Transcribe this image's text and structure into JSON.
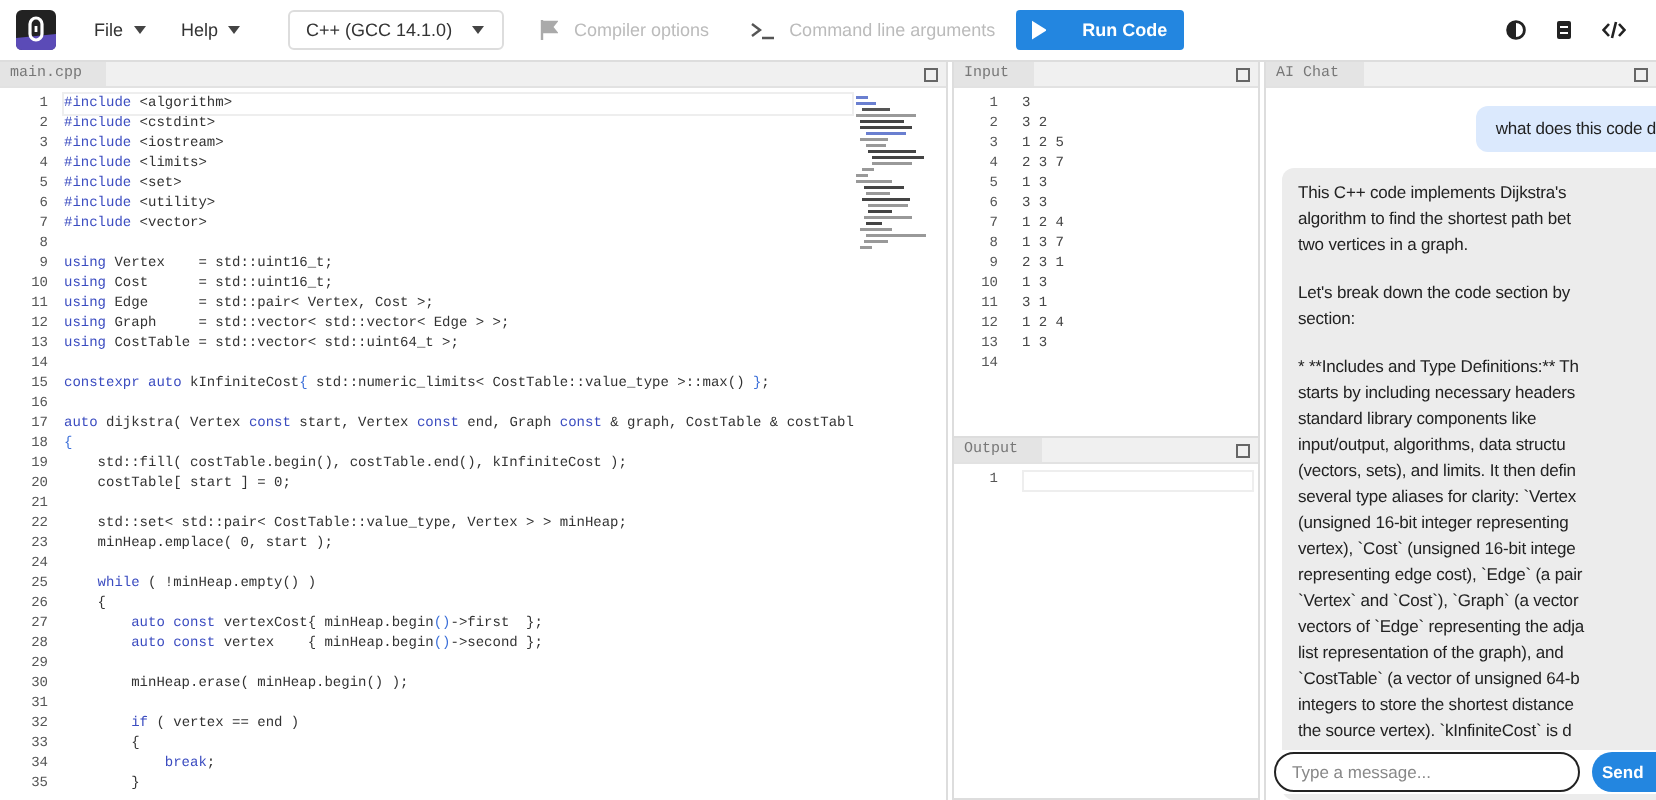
{
  "toolbar": {
    "menus": [
      {
        "label": "File"
      },
      {
        "label": "Help"
      }
    ],
    "language": "C++ (GCC 14.1.0)",
    "options": [
      {
        "label": "Compiler options",
        "kind": "flag",
        "disabled": true
      },
      {
        "label": "Command line arguments",
        "kind": "terminal",
        "disabled": true
      }
    ],
    "run_button": "Run Code"
  },
  "editor": {
    "tab": "main.cpp",
    "lines": [
      {
        "number": "1",
        "tokens": [
          {
            "kind": "keyword",
            "text": "#include"
          },
          {
            "kind": "plain",
            "text": " <algorithm>"
          }
        ]
      },
      {
        "number": "2",
        "tokens": [
          {
            "kind": "keyword",
            "text": "#include"
          },
          {
            "kind": "plain",
            "text": " <cstdint>"
          }
        ]
      },
      {
        "number": "3",
        "tokens": [
          {
            "kind": "keyword",
            "text": "#include"
          },
          {
            "kind": "plain",
            "text": " <iostream>"
          }
        ]
      },
      {
        "number": "4",
        "tokens": [
          {
            "kind": "keyword",
            "text": "#include"
          },
          {
            "kind": "plain",
            "text": " <limits>"
          }
        ]
      },
      {
        "number": "5",
        "tokens": [
          {
            "kind": "keyword",
            "text": "#include"
          },
          {
            "kind": "plain",
            "text": " <set>"
          }
        ]
      },
      {
        "number": "6",
        "tokens": [
          {
            "kind": "keyword",
            "text": "#include"
          },
          {
            "kind": "plain",
            "text": " <utility>"
          }
        ]
      },
      {
        "number": "7",
        "tokens": [
          {
            "kind": "keyword",
            "text": "#include"
          },
          {
            "kind": "plain",
            "text": " <vector>"
          }
        ]
      },
      {
        "number": "8"
      },
      {
        "number": "9",
        "tokens": [
          {
            "kind": "keyword",
            "text": "using"
          },
          {
            "kind": "plain",
            "text": " Vertex    = std::uint16_t;"
          }
        ]
      },
      {
        "number": "10",
        "tokens": [
          {
            "kind": "keyword",
            "text": "using"
          },
          {
            "kind": "plain",
            "text": " Cost      = std::uint16_t;"
          }
        ]
      },
      {
        "number": "11",
        "tokens": [
          {
            "kind": "keyword",
            "text": "using"
          },
          {
            "kind": "plain",
            "text": " Edge      = std::pair< Vertex, Cost >;"
          }
        ]
      },
      {
        "number": "12",
        "tokens": [
          {
            "kind": "keyword",
            "text": "using"
          },
          {
            "kind": "plain",
            "text": " Graph     = std::vector< std::vector< Edge > >;"
          }
        ]
      },
      {
        "number": "13",
        "tokens": [
          {
            "kind": "keyword",
            "text": "using"
          },
          {
            "kind": "plain",
            "text": " CostTable = std::vector< std::uint64_t >;"
          }
        ]
      },
      {
        "number": "14"
      },
      {
        "number": "15",
        "tokens": [
          {
            "kind": "keyword",
            "text": "constexpr auto"
          },
          {
            "kind": "plain",
            "text": " kInfiniteCost"
          },
          {
            "kind": "bracket",
            "text": "{"
          },
          {
            "kind": "plain",
            "text": " std::numeric_limits< CostTable::value_type >::max() "
          },
          {
            "kind": "bracket",
            "text": "}"
          },
          {
            "kind": "plain",
            "text": ";"
          }
        ]
      },
      {
        "number": "16"
      },
      {
        "number": "17",
        "tokens": [
          {
            "kind": "keyword",
            "text": "auto"
          },
          {
            "kind": "plain",
            "text": " dijkstra( Vertex "
          },
          {
            "kind": "keyword",
            "text": "const"
          },
          {
            "kind": "plain",
            "text": " start, Vertex "
          },
          {
            "kind": "keyword",
            "text": "const"
          },
          {
            "kind": "plain",
            "text": " end, Graph "
          },
          {
            "kind": "keyword",
            "text": "const"
          },
          {
            "kind": "plain",
            "text": " & graph, CostTable & costTabl"
          }
        ]
      },
      {
        "number": "18",
        "tokens": [
          {
            "kind": "bracket",
            "text": "{"
          }
        ]
      },
      {
        "number": "19",
        "tokens": [
          {
            "kind": "plain",
            "text": "    std::fill( costTable.begin(), costTable.end(), kInfiniteCost );"
          }
        ]
      },
      {
        "number": "20",
        "tokens": [
          {
            "kind": "plain",
            "text": "    costTable[ start ] = 0;"
          }
        ]
      },
      {
        "number": "21"
      },
      {
        "number": "22",
        "tokens": [
          {
            "kind": "plain",
            "text": "    std::set< std::pair< CostTable::value_type, Vertex > > minHeap;"
          }
        ]
      },
      {
        "number": "23",
        "tokens": [
          {
            "kind": "plain",
            "text": "    minHeap.emplace( 0, start );"
          }
        ]
      },
      {
        "number": "24"
      },
      {
        "number": "25",
        "tokens": [
          {
            "kind": "keyword",
            "text": "    while"
          },
          {
            "kind": "plain",
            "text": " ( !minHeap.empty() )"
          }
        ]
      },
      {
        "number": "26",
        "tokens": [
          {
            "kind": "plain",
            "text": "    {"
          }
        ]
      },
      {
        "number": "27",
        "tokens": [
          {
            "kind": "keyword",
            "text": "        auto const"
          },
          {
            "kind": "plain",
            "text": " vertexCost{ minHeap.begin"
          },
          {
            "kind": "bracket",
            "text": "()"
          },
          {
            "kind": "plain",
            "text": "->first  };"
          }
        ]
      },
      {
        "number": "28",
        "tokens": [
          {
            "kind": "keyword",
            "text": "        auto const"
          },
          {
            "kind": "plain",
            "text": " vertex    { minHeap.begin"
          },
          {
            "kind": "bracket",
            "text": "()"
          },
          {
            "kind": "plain",
            "text": "->second };"
          }
        ]
      },
      {
        "number": "29"
      },
      {
        "number": "30",
        "tokens": [
          {
            "kind": "plain",
            "text": "        minHeap.erase( minHeap.begin() );"
          }
        ]
      },
      {
        "number": "31"
      },
      {
        "number": "32",
        "tokens": [
          {
            "kind": "keyword",
            "text": "        if"
          },
          {
            "kind": "plain",
            "text": " ( vertex == end )"
          }
        ]
      },
      {
        "number": "33",
        "tokens": [
          {
            "kind": "plain",
            "text": "        {"
          }
        ]
      },
      {
        "number": "34",
        "tokens": [
          {
            "kind": "keyword",
            "text": "            break"
          },
          {
            "kind": "plain",
            "text": ";"
          }
        ]
      },
      {
        "number": "35",
        "tokens": [
          {
            "kind": "plain",
            "text": "        }"
          }
        ]
      }
    ]
  },
  "input": {
    "tab": "Input",
    "lines": [
      {
        "number": "1",
        "text": "3"
      },
      {
        "number": "2",
        "text": "3 2"
      },
      {
        "number": "3",
        "text": "1 2 5"
      },
      {
        "number": "4",
        "text": "2 3 7"
      },
      {
        "number": "5",
        "text": "1 3"
      },
      {
        "number": "6",
        "text": "3 3"
      },
      {
        "number": "7",
        "text": "1 2 4"
      },
      {
        "number": "8",
        "text": "1 3 7"
      },
      {
        "number": "9",
        "text": "2 3 1"
      },
      {
        "number": "10",
        "text": "1 3"
      },
      {
        "number": "11",
        "text": "3 1"
      },
      {
        "number": "12",
        "text": "1 2 4"
      },
      {
        "number": "13",
        "text": "1 3"
      },
      {
        "number": "14"
      }
    ]
  },
  "output": {
    "tab": "Output",
    "lines": [
      {
        "number": "1"
      }
    ]
  },
  "chat": {
    "tab": "AI Chat",
    "messages": [
      {
        "kind": "user",
        "paragraphs": [
          [
            "what does this code d"
          ]
        ]
      },
      {
        "kind": "assistant",
        "paragraphs": [
          [
            "This C++ code implements Dijkstra's",
            "algorithm to find the shortest path bet",
            "two vertices in a graph."
          ],
          [
            "Let's break down the code section by",
            "section:"
          ],
          [
            "* **Includes and Type Definitions:** Th",
            "starts by including necessary headers",
            "standard library components like",
            "input/output, algorithms, data structu",
            "(vectors, sets), and limits.  It then defin",
            "several type aliases for clarity: `Vertex",
            "(unsigned 16-bit integer representing",
            "vertex), `Cost` (unsigned 16-bit intege",
            "representing edge cost), `Edge` (a pair",
            "`Vertex` and `Cost`), `Graph` (a vector",
            "vectors of `Edge` representing the adja",
            "list representation of the graph), and",
            "`CostTable` (a vector of unsigned 64-b",
            "integers to store the shortest distance",
            "the source vertex). `kInfiniteCost` is d"
          ]
        ]
      }
    ],
    "composer": {
      "placeholder": "Type a message...",
      "send": "Send"
    }
  }
}
